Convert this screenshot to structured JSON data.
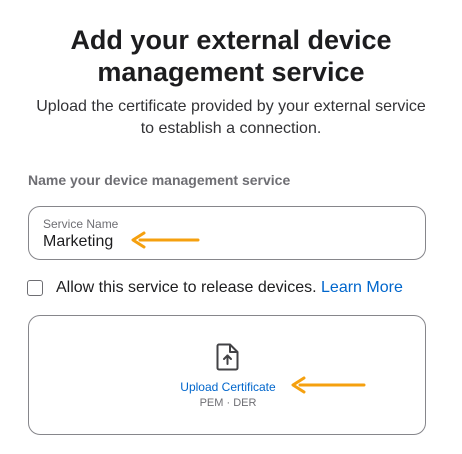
{
  "page": {
    "title": "Add your external device management service",
    "subtitle": "Upload the certificate provided by your external service to establish a connection."
  },
  "form": {
    "section_label": "Name your device management service",
    "service_name": {
      "label": "Service Name",
      "value": "Marketing"
    },
    "release_devices": {
      "label": "Allow this service to release devices.",
      "checked": false,
      "learn_more": "Learn More"
    },
    "upload": {
      "icon": "file-upload-icon",
      "link": "Upload Certificate",
      "formats": "PEM · DER"
    }
  },
  "annotations": {
    "arrow_color": "#f5a00f"
  },
  "colors": {
    "link": "#0066cc",
    "border": "#86868b"
  }
}
